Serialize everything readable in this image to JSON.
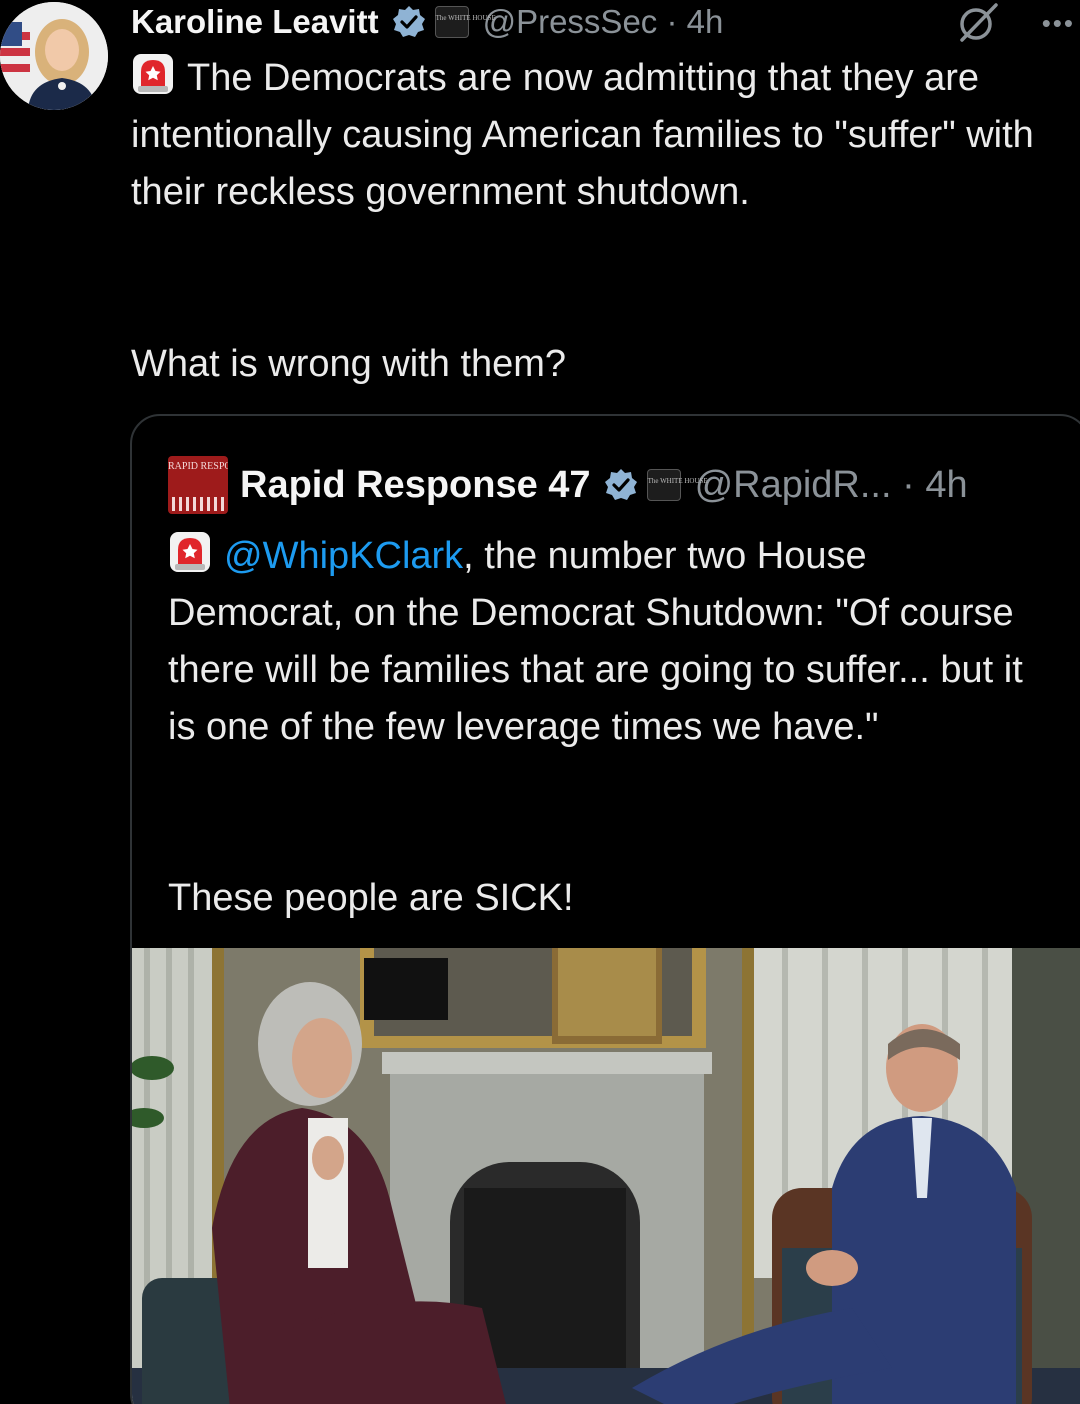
{
  "post": {
    "author_name": "Karoline Leavitt",
    "affiliation_label": "The WHITE HOUSE",
    "handle": "@PressSec",
    "time": "4h",
    "more_label": "•••",
    "text_line1": "The Democrats are now admitting that they are intentionally causing American families to \"suffer\" with their reckless government shutdown.",
    "text_para2": "What is wrong with them?"
  },
  "quote": {
    "logo_text": "RAPID RESPONSE",
    "author_name": "Rapid Response 47",
    "affiliation_label": "The WHITE HOUSE",
    "handle": "@RapidR...",
    "time": "4h",
    "mention": "@WhipKClark",
    "text_after_mention": ", the number two House Democrat, on the Democrat Shutdown: \"Of course there will be families that are going to suffer... but it is one of the few leverage times we have.\"",
    "text_para2": "These people are SICK!"
  },
  "colors": {
    "background": "#000000",
    "text": "#e7e9ea",
    "secondary_text": "#8b9298",
    "link": "#1d9bf0",
    "verified": "#8fb3d4",
    "border": "#2f3336"
  },
  "icons": {
    "verified": "verified-badge-icon",
    "siren": "rotating-light-icon",
    "grok": "grok-icon",
    "more": "more-dots-icon"
  }
}
